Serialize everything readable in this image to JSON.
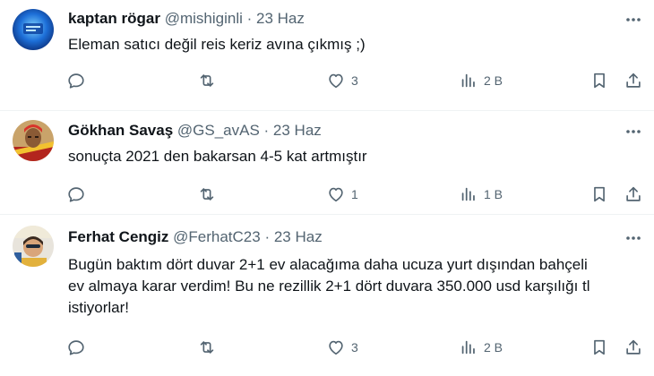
{
  "tweets": [
    {
      "name": "kaptan rögar",
      "handle": "@mishiginli",
      "date": "23 Haz",
      "text": "Eleman satıcı değil reis keriz avına çıkmış ;)",
      "likes": "3",
      "views": "2 B"
    },
    {
      "name": "Gökhan Savaş",
      "handle": "@GS_avAS",
      "date": "23 Haz",
      "text": "sonuçta 2021 den bakarsan 4-5 kat artmıştır",
      "likes": "1",
      "views": "1 B"
    },
    {
      "name": "Ferhat Cengiz",
      "handle": "@FerhatC23",
      "date": "23 Haz",
      "text": "Bugün baktım dört duvar 2+1 ev alacağıma daha ucuza yurt dışından bahçeli ev almaya karar verdim! Bu ne rezillik 2+1 dört duvara 350.000 usd karşılığı tl istiyorlar!",
      "likes": "3",
      "views": "2 B"
    }
  ],
  "separator": " · ",
  "icons": {
    "more": "more-icon",
    "reply": "reply-icon",
    "retweet": "retweet-icon",
    "like": "like-icon",
    "views": "views-icon",
    "bookmark": "bookmark-icon",
    "share": "share-icon"
  },
  "colors": {
    "text": "#0f1419",
    "secondary": "#536471",
    "divider": "#eff3f4"
  }
}
